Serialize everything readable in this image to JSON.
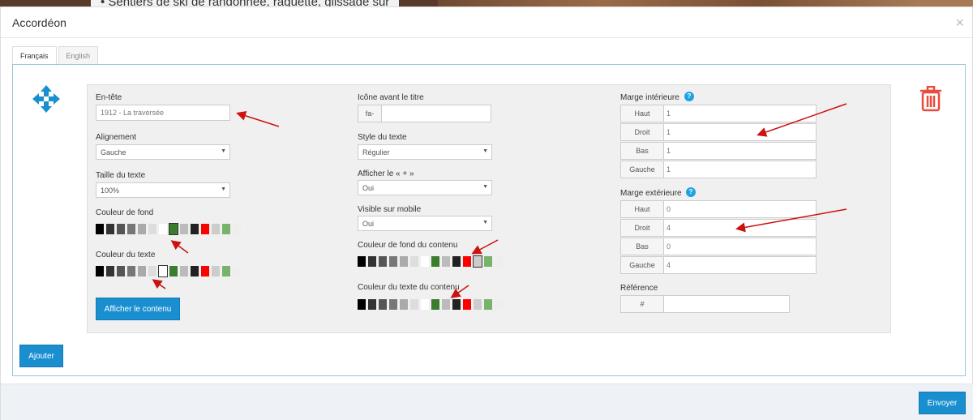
{
  "background": {
    "text": "• Sentiers de ski de randonnée, raquette, glissade sur"
  },
  "modal": {
    "title": "Accordéon",
    "close": "×"
  },
  "tabs": [
    "Français",
    "English"
  ],
  "col1": {
    "header_label": "En-tête",
    "header_value": "1912 - La traversée",
    "align_label": "Alignement",
    "align_value": "Gauche",
    "size_label": "Taille du texte",
    "size_value": "100%",
    "bgcolor_label": "Couleur de fond",
    "textcolor_label": "Couleur du texte",
    "show_content_button": "Afficher le contenu"
  },
  "col2": {
    "icon_label": "Icône avant le titre",
    "icon_prefix": "fa-",
    "icon_value": "",
    "style_label": "Style du texte",
    "style_value": "Régulier",
    "plus_label": "Afficher le « + »",
    "plus_value": "Oui",
    "mobile_label": "Visible sur mobile",
    "mobile_value": "Oui",
    "content_bg_label": "Couleur de fond du contenu",
    "content_text_label": "Couleur du texte du contenu"
  },
  "col3": {
    "padding_label": "Marge intérieure",
    "padding": [
      {
        "side": "Haut",
        "value": "1"
      },
      {
        "side": "Droit",
        "value": "1"
      },
      {
        "side": "Bas",
        "value": "1"
      },
      {
        "side": "Gauche",
        "value": "1"
      }
    ],
    "margin_label": "Marge extérieure",
    "margin": [
      {
        "side": "Haut",
        "value": "0"
      },
      {
        "side": "Droit",
        "value": "4"
      },
      {
        "side": "Bas",
        "value": "0"
      },
      {
        "side": "Gauche",
        "value": "4"
      }
    ],
    "reference_label": "Référence",
    "reference_prefix": "#",
    "reference_value": "",
    "help_glyph": "?"
  },
  "buttons": {
    "add": "Ajouter",
    "send": "Envoyer"
  },
  "swatch_colors": [
    "#000000",
    "#333333",
    "#555555",
    "#777777",
    "#aaaaaa",
    "#dddddd",
    "#ffffff",
    "#3a7d2c",
    "#bbbbbb",
    "#222222",
    "#ff0000",
    "#cccccc",
    "#77b36a",
    "#eeeeee"
  ],
  "selected": {
    "bgcolor": 7,
    "textcolor": 6,
    "content_bg": 11
  },
  "colors": {
    "accent": "#1a8fd0",
    "trash": "#e84c3d",
    "move": "#1a8fd0",
    "arrow": "#cc1111"
  },
  "icons": {
    "move": "move-arrows-icon",
    "trash": "trash-icon",
    "help": "help-icon",
    "close": "close-icon"
  }
}
